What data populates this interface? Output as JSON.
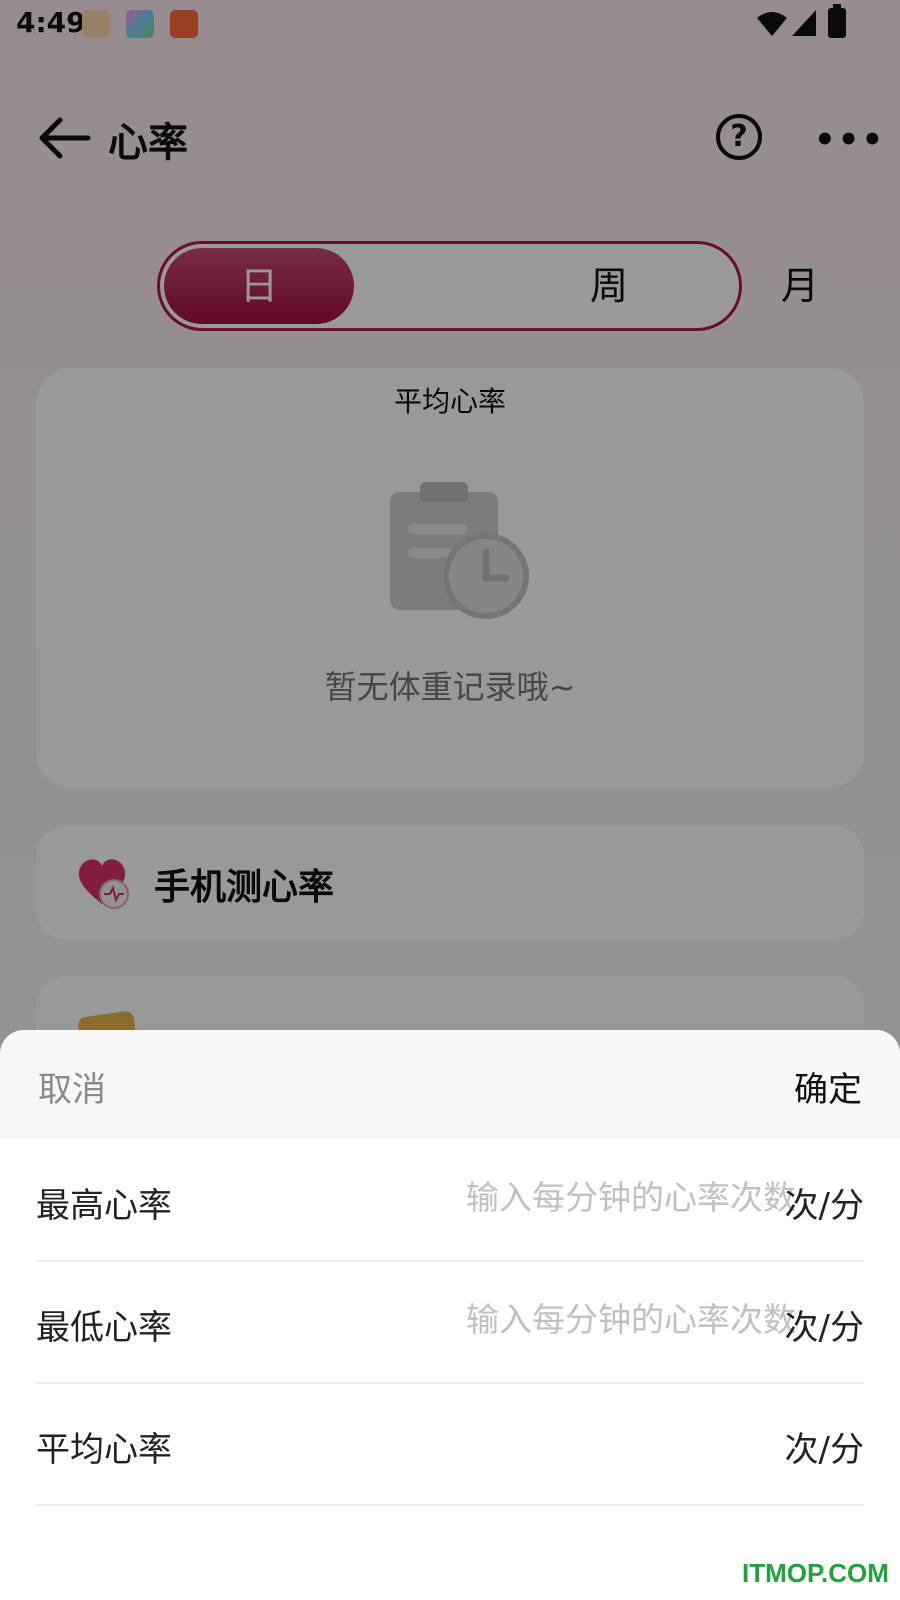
{
  "status_bar": {
    "time": "4:49",
    "icons": [
      "notification-cat-icon",
      "notification-app-icon",
      "notification-book-icon",
      "wifi-icon",
      "signal-icon",
      "battery-charging-icon"
    ]
  },
  "header": {
    "title": "心率",
    "icons": [
      "back-arrow-icon",
      "help-icon",
      "more-icon"
    ]
  },
  "tabs": [
    {
      "label": "日",
      "active": true
    },
    {
      "label": "周",
      "active": false
    },
    {
      "label": "月",
      "active": false
    }
  ],
  "summary_card": {
    "title": "平均心率",
    "empty_text": "暂无体重记录哦~",
    "icon": "clipboard-clock-icon"
  },
  "list": {
    "measure_label": "手机测心率",
    "measure_icon": "heart-pulse-icon"
  },
  "sheet": {
    "cancel_label": "取消",
    "confirm_label": "确定",
    "fields": [
      {
        "label": "最高心率",
        "placeholder": "输入每分钟的心率次数",
        "unit": "次/分"
      },
      {
        "label": "最低心率",
        "placeholder": "输入每分钟的心率次数",
        "unit": "次/分"
      },
      {
        "label": "平均心率",
        "placeholder": "",
        "unit": "次/分"
      }
    ]
  },
  "watermark": "ITMOP.COM",
  "colors": {
    "accent": "#a50d43",
    "overlay": "#000000"
  }
}
